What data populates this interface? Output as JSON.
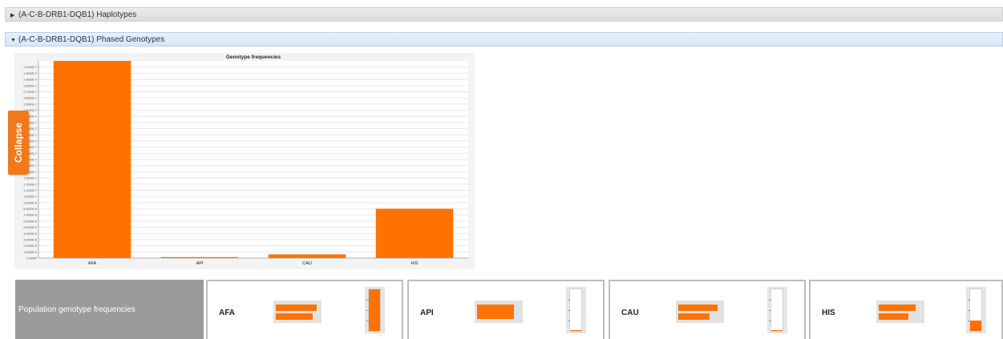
{
  "panels": [
    {
      "title": "(A-C-B-DRB1-DQB1) Haplotypes",
      "expanded": false
    },
    {
      "title": "(A-C-B-DRB1-DQB1) Phased Genotypes",
      "expanded": true
    }
  ],
  "collapse_label": "Collapse",
  "population_label": "Population genotype frequencies",
  "chart_data": {
    "type": "bar",
    "title": "Genotype frequencies",
    "categories": [
      "AFA",
      "API",
      "CAU",
      "HIS"
    ],
    "values": [
      3.2e-07,
      1e-09,
      6e-09,
      8e-08
    ],
    "ylim": [
      0,
      3.2e-07
    ],
    "grid": true,
    "bar_color": "#ff7200",
    "y_ticks": [
      "0.00000",
      "1.0000E-8",
      "2.0000E-8",
      "3.0000E-8",
      "4.0000E-8",
      "5.0000E-8",
      "6.0000E-8",
      "7.0000E-8",
      "8.0000E-8",
      "9.0000E-8",
      "1.0000E-7",
      "1.1000E-7",
      "1.2000E-7",
      "1.3000E-7",
      "1.4000E-7",
      "1.5000E-7",
      "1.6000E-7",
      "1.7000E-7",
      "1.8000E-7",
      "1.9000E-7",
      "2.0000E-7",
      "2.1000E-7",
      "2.2000E-7",
      "2.3000E-7",
      "2.4000E-7",
      "2.5000E-7",
      "2.6000E-7",
      "2.7000E-7",
      "2.8000E-7",
      "2.9000E-7",
      "3.0000E-7",
      "3.1000E-7"
    ]
  },
  "population_cards": [
    {
      "name": "AFA",
      "bars": [
        0.95,
        0.85
      ],
      "column_fill": 1.0
    },
    {
      "name": "API",
      "bars": [
        0.85
      ],
      "column_fill": 0.01
    },
    {
      "name": "CAU",
      "bars": [
        0.9,
        0.72
      ],
      "column_fill": 0.02
    },
    {
      "name": "HIS",
      "bars": [
        0.85,
        0.68
      ],
      "column_fill": 0.25
    }
  ]
}
